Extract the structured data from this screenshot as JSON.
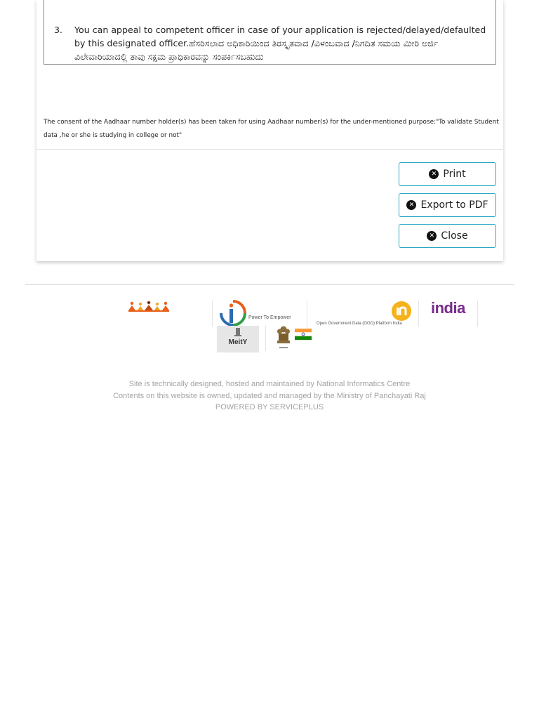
{
  "notice": {
    "item_number": "3.",
    "item_text": "You can appeal to competent officer in case of your application is rejected/delayed/defaulted by this designated officer.ಹೆಸರಿಸಲಾದ ಅಧಿಕಾರಿಯಿಂದ ತಿರಸ್ಕೃತವಾದ /ವಿಳಂಬವಾದ /ನಿಗದಿತ ಸಮಯ ಮೀರಿ ಅರ್ಜಿ ವಿಲೇವಾರಿಯಾದಲ್ಲಿ ತಾವು ಸಕ್ಷಮ ಪ್ರಾಧಿಕಾರವನ್ನು ಸಂಪರ್ಕಿಸಬಹುದು"
  },
  "consent_text": "The consent of the Aadhaar number holder(s) has been taken for using Aadhaar number(s) for the under-mentioned purpose:\"To validate Student data ,he or she is studying in college or not\"",
  "actions": {
    "print_label": "Print",
    "export_label": "Export to PDF",
    "close_label": "Close"
  },
  "logos": {
    "digital_india_tagline": "Power To Empower",
    "ogd_text": "Open Government Data (OGD) Platform India",
    "india_gov_text": "india",
    "meity_text": "MeitY"
  },
  "footer": {
    "line1": "Site is technically designed, hosted and maintained by National Informatics Centre",
    "line2": "Contents on this website is owned, updated and managed by the Ministry of Panchayati Raj",
    "line3": "POWERED BY SERVICEPLUS"
  },
  "colors": {
    "button_border": "#2aa9c4",
    "ogd_yellow": "#f5b21a",
    "india_purple": "#7a2a8c",
    "india_teal": "#1aa1a8",
    "footer_text": "#a3a3a3"
  }
}
